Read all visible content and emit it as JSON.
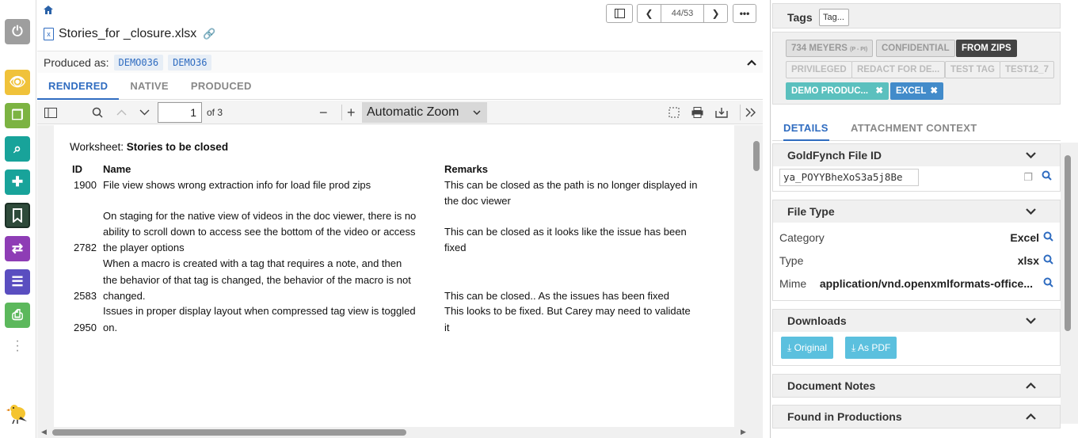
{
  "file": {
    "name": "Stories_for _closure.xlsx",
    "nav": "44/53"
  },
  "produced": {
    "label": "Produced as:",
    "chips": [
      "DEMO036",
      "DEMO36"
    ]
  },
  "tabs": [
    "RENDERED",
    "NATIVE",
    "PRODUCED"
  ],
  "pdf": {
    "page": "1",
    "of": "of 3",
    "zoom": "Automatic Zoom"
  },
  "sheet": {
    "label": "Worksheet: ",
    "name": "Stories to be closed",
    "headers": {
      "id": "ID",
      "name": "Name",
      "remarks": "Remarks"
    },
    "rows": [
      {
        "id": "1900",
        "name": [
          "File view shows wrong extraction info for load file prod zips"
        ],
        "remarks": [
          "This can be closed as the path is no longer displayed in",
          "the doc viewer"
        ]
      },
      {
        "id": "2782",
        "name": [
          "On staging for the native view of videos in the doc viewer, there is no",
          "ability to scroll down to access see the bottom of the video or access",
          "the player options"
        ],
        "remarks": [
          "This can be closed as it looks like the issue has been",
          "fixed"
        ]
      },
      {
        "id": "2583",
        "name": [
          "When a macro is created with a tag that requires a note, and then",
          "the behavior of that tag is changed, the behavior of the macro is not",
          "changed."
        ],
        "remarks": [
          "This can be closed.. As the issues has been fixed"
        ]
      },
      {
        "id": "2950",
        "name": [
          "Issues in proper display layout when compressed tag view is toggled",
          "on."
        ],
        "remarks": [
          "This looks to be fixed. But Carey may need to validate",
          "it"
        ]
      }
    ]
  },
  "tags": {
    "label": "Tags",
    "input_placeholder": "Tag...",
    "items": [
      {
        "text": "734 MEYERS",
        "sub": "(P - PI)",
        "style": "out2"
      },
      {
        "text": "CONFIDENTIAL",
        "style": "out2"
      },
      {
        "text": "FROM ZIPS",
        "style": "dark"
      },
      {
        "text": "PRIVILEGED",
        "style": "out"
      },
      {
        "text": "REDACT FOR DE...",
        "style": "out"
      },
      {
        "text": "TEST TAG",
        "style": "out"
      },
      {
        "text": "TEST12_7",
        "style": "out"
      },
      {
        "text": "DEMO PRODUC...",
        "style": "teal",
        "removable": true
      },
      {
        "text": "EXCEL",
        "style": "blue",
        "removable": true
      }
    ]
  },
  "right_tabs": [
    "DETAILS",
    "ATTACHMENT CONTEXT"
  ],
  "details": {
    "file_id": {
      "title": "GoldFynch File ID",
      "value": "ya_POYYBheXoS3a5j8Be"
    },
    "file_type": {
      "title": "File Type",
      "rows": [
        {
          "label": "Category",
          "value": "Excel"
        },
        {
          "label": "Type",
          "value": "xlsx"
        },
        {
          "label": "Mime",
          "value": "application/vnd.openxmlformats-office..."
        }
      ]
    },
    "downloads": {
      "title": "Downloads",
      "original": "Original",
      "pdf": "As PDF"
    },
    "notes": {
      "title": "Document Notes"
    },
    "productions": {
      "title": "Found in Productions"
    }
  },
  "colors": {
    "accent": "#2f6cc0",
    "rail": [
      "#9e9e9e",
      "#f0c23a",
      "#7cb342",
      "#18a39a",
      "#18a39a",
      "#2e4a3a",
      "#8e3db5",
      "#5a4ec0",
      "#5cb85c"
    ]
  }
}
